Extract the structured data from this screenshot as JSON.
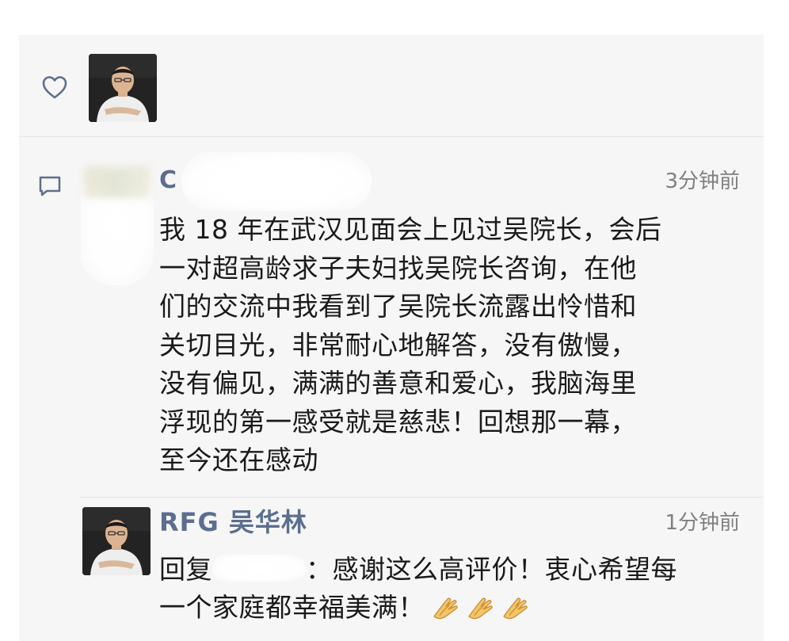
{
  "likes": {
    "icon": "heart-icon"
  },
  "comment": {
    "icon": "comment-icon",
    "author": "C",
    "time": "3分钟前",
    "text": "我 18 年在武汉见面会上见过吴院长，会后\n一对超高龄求子夫妇找吴院长咨询，在他\n们的交流中我看到了吴院长流露出怜惜和\n关切目光，非常耐心地解答，没有傲慢，\n没有偏见，满满的善意和爱心，我脑海里\n浮现的第一感受就是慈悲！回想那一幕，\n至今还在感动"
  },
  "reply": {
    "author": "RFG 吴华林",
    "time": "1分钟前",
    "prefix": "回复",
    "body_line1": "：感谢这么高评价！衷心希望每",
    "body_line2": "一个家庭都幸福美满！",
    "emoji": [
      "clap-icon",
      "clap-icon",
      "clap-icon"
    ]
  },
  "colors": {
    "panel_bg": "#f6f6f6",
    "name_color": "#5c6e8f",
    "time_color": "#808080",
    "text_color": "#1a1a1a"
  }
}
